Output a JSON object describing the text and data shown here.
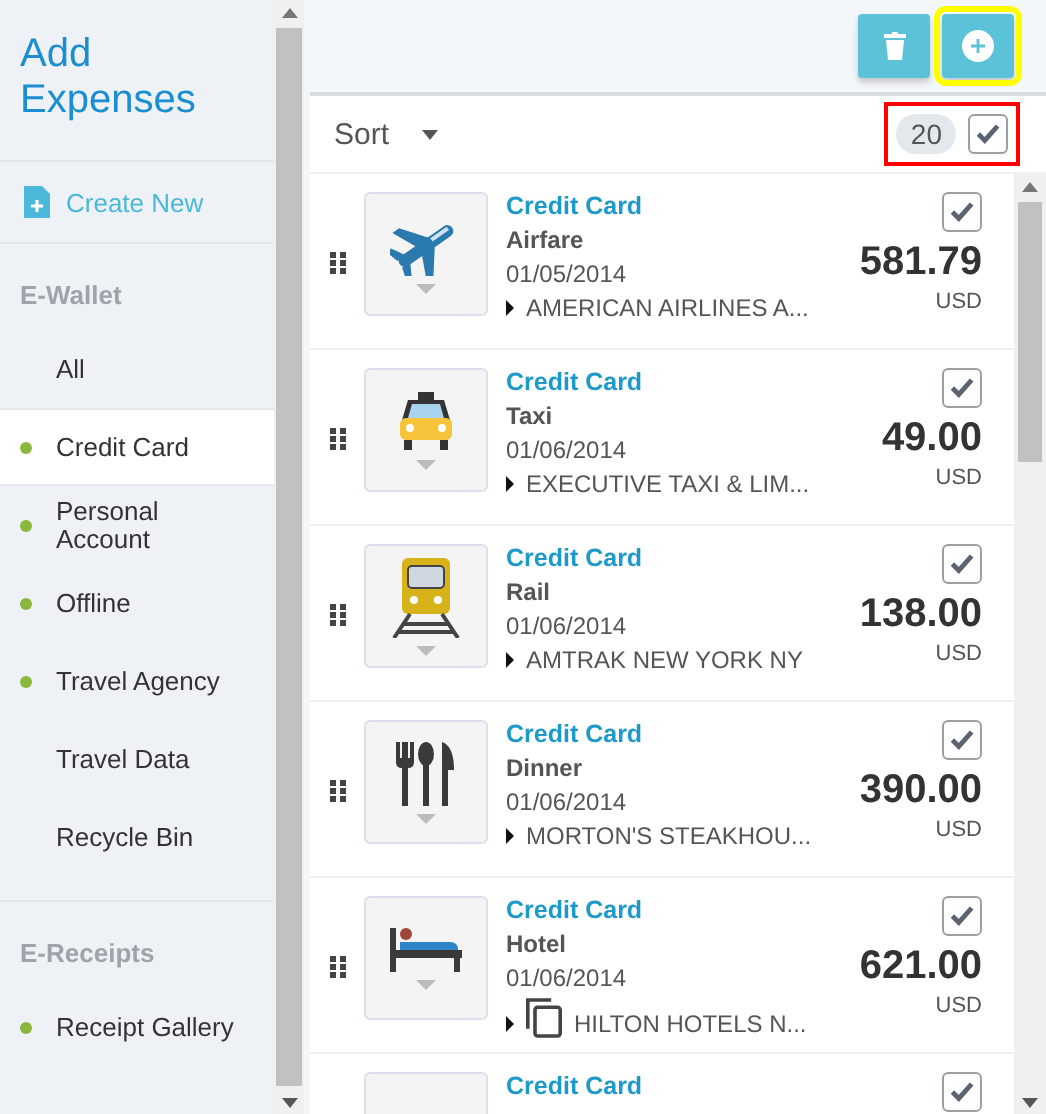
{
  "sidebar": {
    "title": "Add Expenses",
    "create_button": "Create New",
    "sections": [
      {
        "header": "E-Wallet",
        "items": [
          {
            "label": "All",
            "marked": false,
            "selected": false
          },
          {
            "label": "Credit Card",
            "marked": true,
            "selected": true
          },
          {
            "label": "Personal Account",
            "marked": true,
            "selected": false
          },
          {
            "label": "Offline",
            "marked": true,
            "selected": false
          },
          {
            "label": "Travel Agency",
            "marked": true,
            "selected": false
          },
          {
            "label": "Travel Data",
            "marked": false,
            "selected": false
          },
          {
            "label": "Recycle Bin",
            "marked": false,
            "selected": false
          }
        ]
      },
      {
        "header": "E-Receipts",
        "items": [
          {
            "label": "Receipt Gallery",
            "marked": true,
            "selected": false
          }
        ]
      }
    ]
  },
  "toolbar": {
    "delete_highlighted": false,
    "add_highlighted": true
  },
  "list_header": {
    "sort_label": "Sort",
    "count": "20",
    "select_all_checked": true,
    "highlighted": true
  },
  "expenses": [
    {
      "kind": "airfare",
      "category": "Credit Card",
      "title": "Airfare",
      "date": "01/05/2014",
      "merchant": "AMERICAN AIRLINES A...",
      "has_copy": false,
      "amount": "581.79",
      "currency": "USD",
      "checked": true
    },
    {
      "kind": "taxi",
      "category": "Credit Card",
      "title": "Taxi",
      "date": "01/06/2014",
      "merchant": "EXECUTIVE TAXI & LIM...",
      "has_copy": false,
      "amount": "49.00",
      "currency": "USD",
      "checked": true
    },
    {
      "kind": "rail",
      "category": "Credit Card",
      "title": "Rail",
      "date": "01/06/2014",
      "merchant": "AMTRAK NEW YORK NY",
      "has_copy": false,
      "amount": "138.00",
      "currency": "USD",
      "checked": true
    },
    {
      "kind": "dinner",
      "category": "Credit Card",
      "title": "Dinner",
      "date": "01/06/2014",
      "merchant": "MORTON'S STEAKHOU...",
      "has_copy": false,
      "amount": "390.00",
      "currency": "USD",
      "checked": true
    },
    {
      "kind": "hotel",
      "category": "Credit Card",
      "title": "Hotel",
      "date": "01/06/2014",
      "merchant": "HILTON HOTELS N...",
      "has_copy": true,
      "amount": "621.00",
      "currency": "USD",
      "checked": true
    },
    {
      "kind": "partial",
      "category": "Credit Card",
      "checked": true
    }
  ]
}
